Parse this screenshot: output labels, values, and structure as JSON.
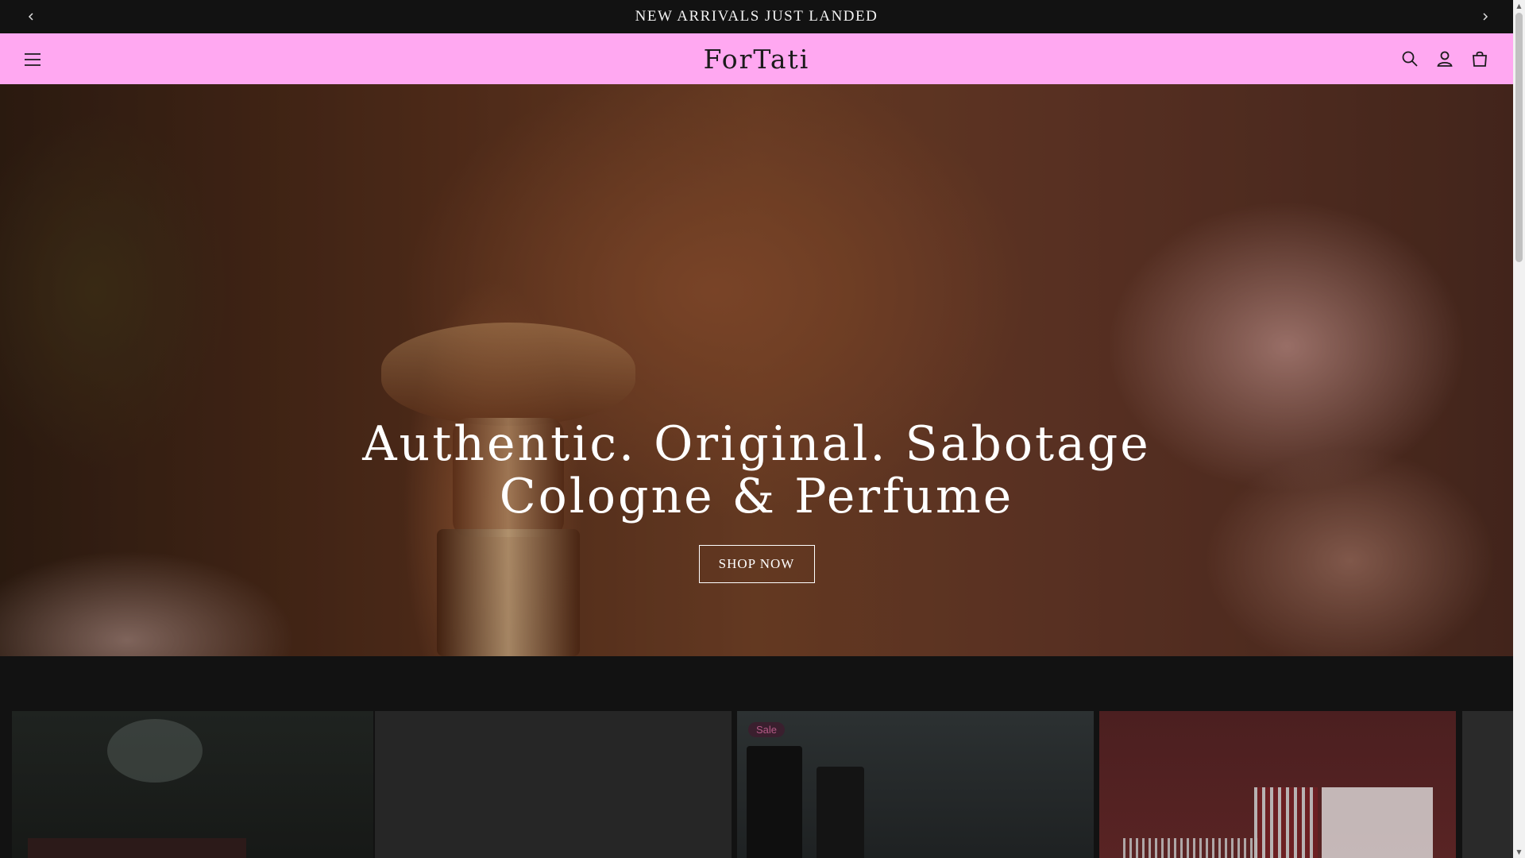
{
  "announcement": {
    "text": "NEW ARRIVALS JUST LANDED",
    "prev_icon": "chevron-left-icon",
    "next_icon": "chevron-right-icon"
  },
  "header": {
    "logo": "ForTati",
    "background": "#ffa8f1",
    "menu_icon": "hamburger-icon",
    "search_icon": "search-icon",
    "account_icon": "user-icon",
    "cart_icon": "cart-icon"
  },
  "hero": {
    "headline_line1": "Authentic. Original. Sabotage",
    "headline_line2": "Cologne & Perfume",
    "cta_label": "SHOP NOW"
  },
  "products": {
    "sale_badge": "Sale"
  },
  "scrollbar": {
    "up_glyph": "▲",
    "down_glyph": "▼"
  }
}
